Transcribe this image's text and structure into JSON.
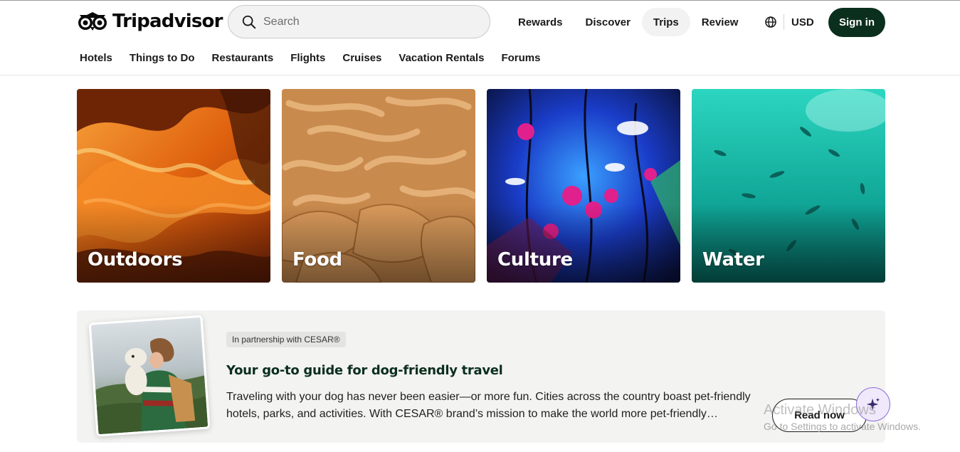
{
  "header": {
    "brand": "Tripadvisor",
    "search": {
      "placeholder": "Search"
    },
    "nav": [
      {
        "label": "Rewards"
      },
      {
        "label": "Discover"
      },
      {
        "label": "Trips"
      },
      {
        "label": "Review"
      }
    ],
    "currency": "USD",
    "signin_label": "Sign in",
    "brand_color": "#0b2f1d"
  },
  "categories": [
    {
      "label": "Hotels"
    },
    {
      "label": "Things to Do"
    },
    {
      "label": "Restaurants"
    },
    {
      "label": "Flights"
    },
    {
      "label": "Cruises"
    },
    {
      "label": "Vacation Rentals"
    },
    {
      "label": "Forums"
    }
  ],
  "tiles": [
    {
      "label": "Outdoors"
    },
    {
      "label": "Food"
    },
    {
      "label": "Culture"
    },
    {
      "label": "Water"
    }
  ],
  "promo": {
    "badge": "In partnership with CESAR®",
    "title": "Your go-to guide for dog-friendly travel",
    "body": "Traveling with your dog has never been easier—or more fun. Cities across the country boast pet-friendly hotels, parks, and activities. With CESAR® brand’s mission to make the world more pet-friendly…",
    "cta": "Read now"
  },
  "watermark": {
    "line1": "Activate Windows",
    "line2": "Go to Settings to activate Windows."
  }
}
